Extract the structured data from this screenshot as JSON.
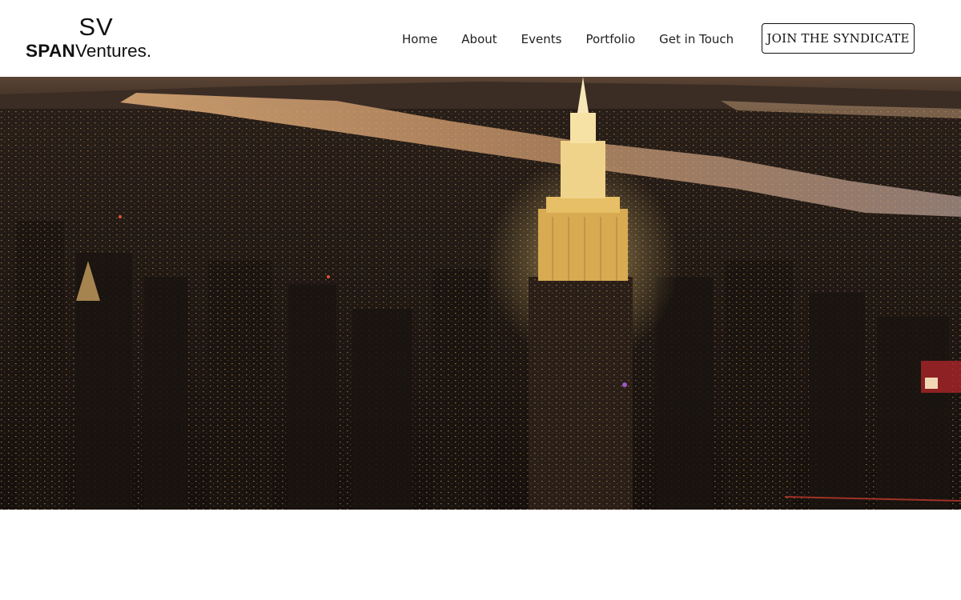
{
  "brand": {
    "monogram": "SV",
    "name_bold": "SPAN",
    "name_light": "Ventures."
  },
  "nav": {
    "items": [
      {
        "label": "Home"
      },
      {
        "label": "About"
      },
      {
        "label": "Events"
      },
      {
        "label": "Portfolio"
      },
      {
        "label": "Get in Touch"
      }
    ]
  },
  "cta": {
    "label": "JOIN THE SYNDICATE"
  },
  "hero": {
    "image": "aerial-night-city-skyline-with-river-and-illuminated-tower",
    "colors": {
      "sky": "#6b4a32",
      "river": "#b58a63",
      "city": "#1f1814",
      "tower_light": "#f2c86a"
    }
  }
}
